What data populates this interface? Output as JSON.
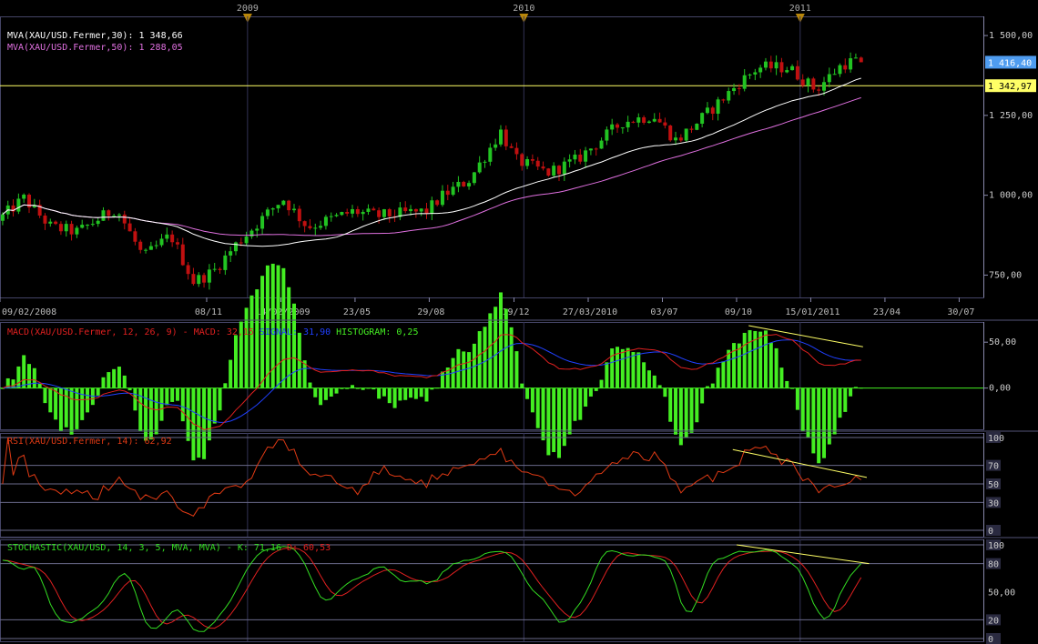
{
  "years": [
    {
      "label": "2009",
      "date": "2009-01-01"
    },
    {
      "label": "2010",
      "date": "2010-01-01"
    },
    {
      "label": "2011",
      "date": "2011-01-01"
    }
  ],
  "date_ticks": [
    {
      "label": "09/02/2008",
      "date": "2008-02-09"
    },
    {
      "label": "08/11",
      "date": "2008-11-08"
    },
    {
      "label": "14/02/2009",
      "date": "2009-02-14"
    },
    {
      "label": "23/05",
      "date": "2009-05-23"
    },
    {
      "label": "29/08",
      "date": "2009-08-29"
    },
    {
      "label": "19/12",
      "date": "2009-12-19"
    },
    {
      "label": "27/03/2010",
      "date": "2010-03-27"
    },
    {
      "label": "03/07",
      "date": "2010-07-03"
    },
    {
      "label": "09/10",
      "date": "2010-10-09"
    },
    {
      "label": "15/01/2011",
      "date": "2011-01-15"
    },
    {
      "label": "23/04",
      "date": "2011-04-23"
    },
    {
      "label": "30/07",
      "date": "2011-07-30"
    }
  ],
  "colors": {
    "candle_up": "#22c322",
    "candle_down": "#c01010",
    "mva30": "#ffffff",
    "mva50": "#e070e0",
    "hline": "#ffff66",
    "macd": "#e02020",
    "signal": "#2040ff",
    "histogram": "#44ee22",
    "rsi": "#e03a14",
    "stoch_k": "#33dd22",
    "stoch_d": "#e02020",
    "grid": "#6a6a8a",
    "last_price_bg": "#4f9cf0",
    "hline_bg": "#ffff66"
  },
  "chart_data": [
    {
      "type": "candlestick",
      "name": "price",
      "legend": [
        {
          "text": "MVA(XAU/USD.Fermer,30): 1 348,66"
        },
        {
          "text": "MVA(XAU/USD.Fermer,50): 1 288,05"
        }
      ],
      "y_ticks": [
        "1 500,00",
        "1 250,00",
        "1 000,00",
        "750,00"
      ],
      "y_tick_values": [
        1500,
        1250,
        1000,
        750
      ],
      "ylim": [
        680,
        1560
      ],
      "last_price": {
        "label": "1 416,40",
        "value": 1416.4
      },
      "horizontal_line": {
        "label": "1 342,97",
        "value": 1342.97
      },
      "mva30_last": 1348.66,
      "mva50_last": 1288.05
    },
    {
      "type": "line",
      "name": "macd",
      "legend": [
        {
          "text": "MACD(XAU/USD.Fermer, 12, 26, 9) - MACD: 32,15",
          "color": "macd"
        },
        {
          "text": "SIGNAL: 31,90",
          "color": "signal"
        },
        {
          "text": "HISTOGRAM: 0,25",
          "color": "histogram"
        }
      ],
      "y_ticks": [
        "50,00",
        "0,00"
      ],
      "y_tick_values": [
        50,
        0
      ],
      "ylim": [
        -45,
        72
      ],
      "macd_last": 32.15,
      "signal_last": 31.9,
      "histogram_last": 0.25,
      "trendline": [
        [
          "2010-10-25",
          68
        ],
        [
          "2011-03-25",
          45
        ]
      ]
    },
    {
      "type": "line",
      "name": "rsi",
      "legend": [
        {
          "text": "RSI(XAU/USD.Fermer, 14): 62,92",
          "color": "rsi"
        }
      ],
      "y_ticks": [
        "100",
        "70",
        "50",
        "30",
        "0"
      ],
      "y_tick_values": [
        100,
        70,
        50,
        30,
        0
      ],
      "ylim": [
        0,
        100
      ],
      "last": 62.92,
      "trendline": [
        [
          "2010-10-04",
          87
        ],
        [
          "2011-03-30",
          57
        ]
      ]
    },
    {
      "type": "line",
      "name": "stochastic",
      "legend": [
        {
          "text": "STOCHASTIC(XAU/USD, 14, 3, 5, MVA, MVA) -",
          "color": "stoch_k"
        },
        {
          "text": "K: 71,16",
          "color": "stoch_k"
        },
        {
          "text": "D: 60,53",
          "color": "stoch_d"
        }
      ],
      "y_ticks": [
        "100",
        "80",
        "50,00",
        "20",
        "0"
      ],
      "y_tick_values": [
        100,
        80,
        50,
        20,
        0
      ],
      "ylim": [
        0,
        100
      ],
      "k_last": 71.16,
      "d_last": 60.53,
      "trendline": [
        [
          "2010-10-09",
          100
        ],
        [
          "2011-04-02",
          80
        ]
      ]
    }
  ]
}
